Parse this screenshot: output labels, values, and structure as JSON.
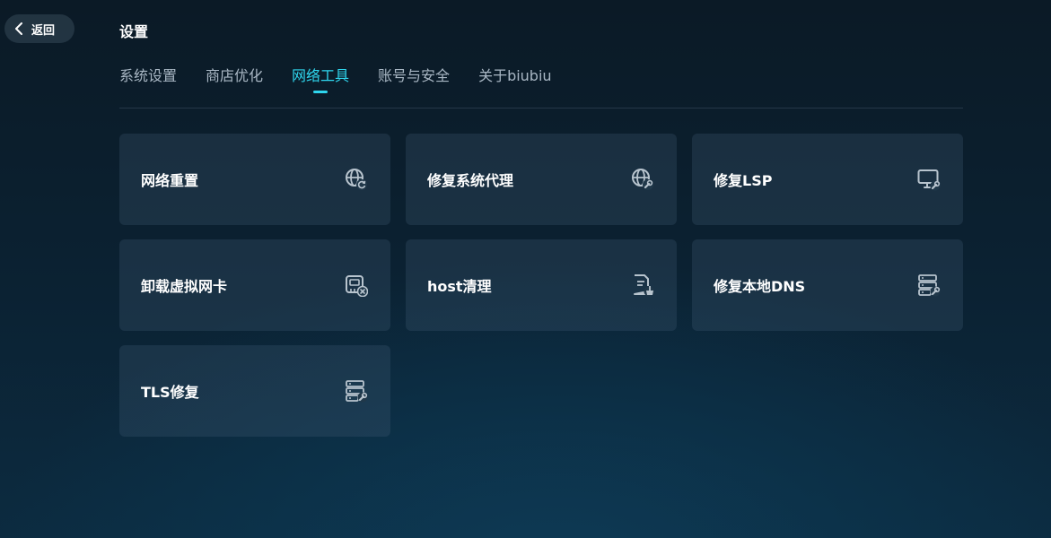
{
  "header": {
    "back_label": "返回",
    "title": "设置"
  },
  "tabs": [
    {
      "label": "系统设置",
      "active": false
    },
    {
      "label": "商店优化",
      "active": false
    },
    {
      "label": "网络工具",
      "active": true
    },
    {
      "label": "账号与安全",
      "active": false
    },
    {
      "label": "关于biubiu",
      "active": false
    }
  ],
  "tools": [
    {
      "label": "网络重置",
      "icon": "globe-refresh-icon"
    },
    {
      "label": "修复系统代理",
      "icon": "globe-wrench-icon"
    },
    {
      "label": "修复LSP",
      "icon": "monitor-wrench-icon"
    },
    {
      "label": "卸载虚拟网卡",
      "icon": "network-card-remove-icon"
    },
    {
      "label": "host清理",
      "icon": "document-broom-icon"
    },
    {
      "label": "修复本地DNS",
      "icon": "server-wrench-icon"
    },
    {
      "label": "TLS修复",
      "icon": "server-wrench-icon"
    }
  ],
  "colors": {
    "accent": "#2fd6ee",
    "icon": "#b8c4ce"
  }
}
